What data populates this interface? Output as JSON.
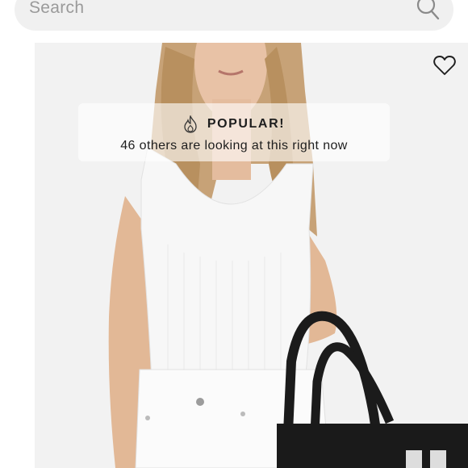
{
  "search": {
    "placeholder": "Search",
    "icon": "search-icon"
  },
  "product": {
    "image_alt": "Model wearing white ribbed tank bodysuit and white jeans holding a black tote bag",
    "wishlist_icon": "heart-outline-icon",
    "banner": {
      "icon": "flame-icon",
      "title": "POPULAR!",
      "subtitle": "46 others are looking at this right now"
    }
  },
  "colors": {
    "search_bg": "#f0f0f0",
    "image_bg": "#f2f2f2",
    "text": "#1e1e1e",
    "placeholder": "#9a9a9a"
  }
}
